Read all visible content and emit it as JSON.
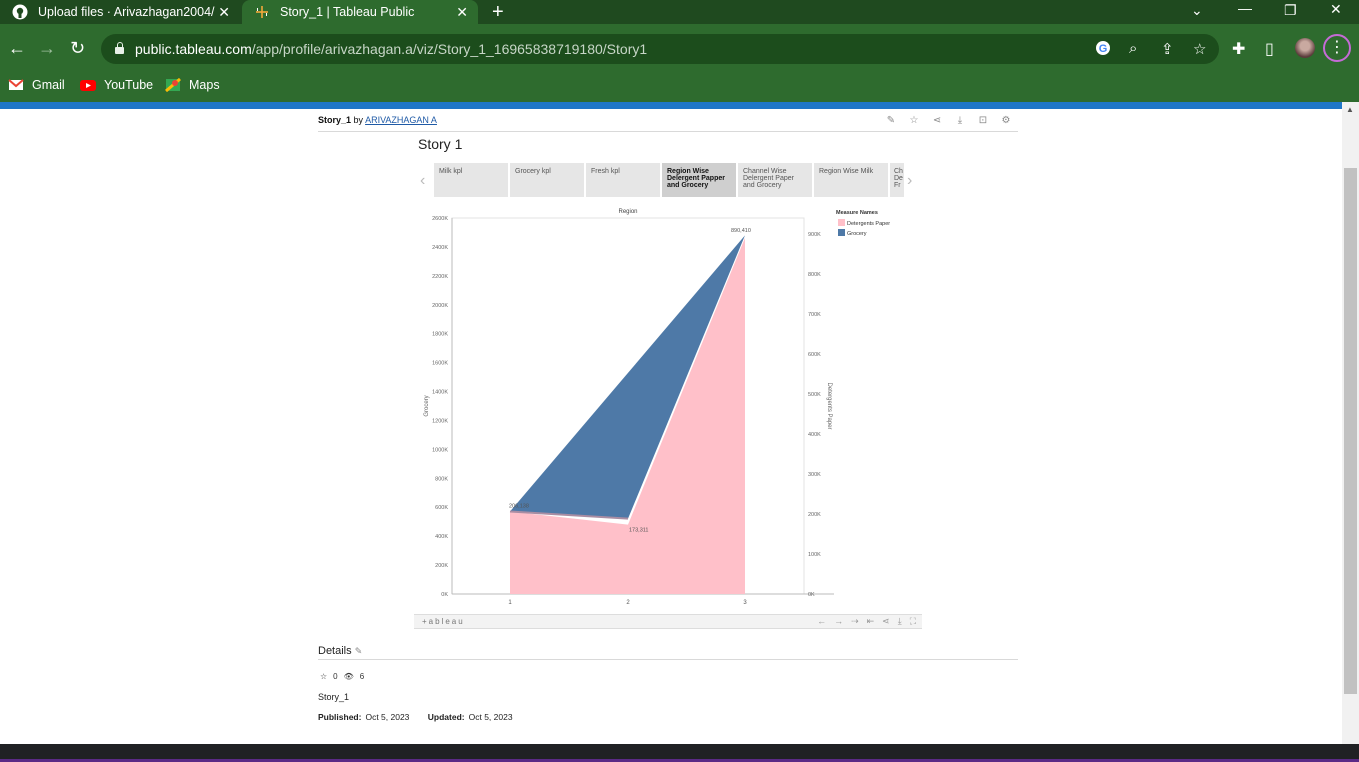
{
  "browser": {
    "tabs": [
      {
        "title": "Upload files · Arivazhagan2004/",
        "icon": "github-icon"
      },
      {
        "title": "Story_1 | Tableau Public",
        "icon": "tableau-icon"
      }
    ],
    "url_host": "public.tableau.com",
    "url_path": "/app/profile/arivazhagan.a/viz/Story_1_16965838719180/Story1",
    "bookmarks": [
      {
        "label": "Gmail",
        "icon": "gmail-icon"
      },
      {
        "label": "YouTube",
        "icon": "youtube-icon"
      },
      {
        "label": "Maps",
        "icon": "maps-icon"
      }
    ]
  },
  "page": {
    "viz_name": "Story_1",
    "by": "by",
    "author": "ARIVAZHAGAN A",
    "story_title": "Story 1",
    "story_points": [
      "Milk kpl",
      "Grocery kpl",
      "Fresh kpl",
      "Region Wise Delergent Papper and Grocery",
      "Channel Wise Delergent Paper and Grocery",
      "Region Wise Milk",
      "Ch De Fr"
    ],
    "tableau_logo": "+ableau",
    "details_label": "Details",
    "favorites": "0",
    "views": "6",
    "description": "Story_1",
    "published_label": "Published:",
    "published_date": "Oct 5, 2023",
    "updated_label": "Updated:",
    "updated_date": "Oct 5, 2023"
  },
  "chart_data": {
    "type": "area",
    "title": "Region",
    "x": [
      1,
      2,
      3
    ],
    "x_ticks": [
      "1",
      "2",
      "3"
    ],
    "left_axis": {
      "label": "Grocery",
      "ticks": [
        "0K",
        "200K",
        "400K",
        "600K",
        "800K",
        "1000K",
        "1200K",
        "1400K",
        "1600K",
        "1800K",
        "2000K",
        "2200K",
        "2400K",
        "2600K"
      ],
      "range": [
        0,
        2600000
      ]
    },
    "right_axis": {
      "label": "Detergents Paper",
      "ticks": [
        "0K",
        "100K",
        "200K",
        "300K",
        "400K",
        "500K",
        "600K",
        "700K",
        "800K",
        "900K"
      ],
      "range": [
        0,
        940000
      ]
    },
    "legend_title": "Measure Names",
    "series": [
      {
        "name": "Detergents Paper",
        "axis": "right",
        "values": [
          206138,
          173311,
          890410
        ],
        "color": "#ffc0c9"
      },
      {
        "name": "Grocery",
        "axis": "left",
        "values": [
          570000,
          500000,
          2480000
        ],
        "color": "#4e79a7"
      }
    ],
    "data_labels": [
      "206,138",
      "173,311",
      "890,410"
    ],
    "legend_position": "top-right"
  }
}
